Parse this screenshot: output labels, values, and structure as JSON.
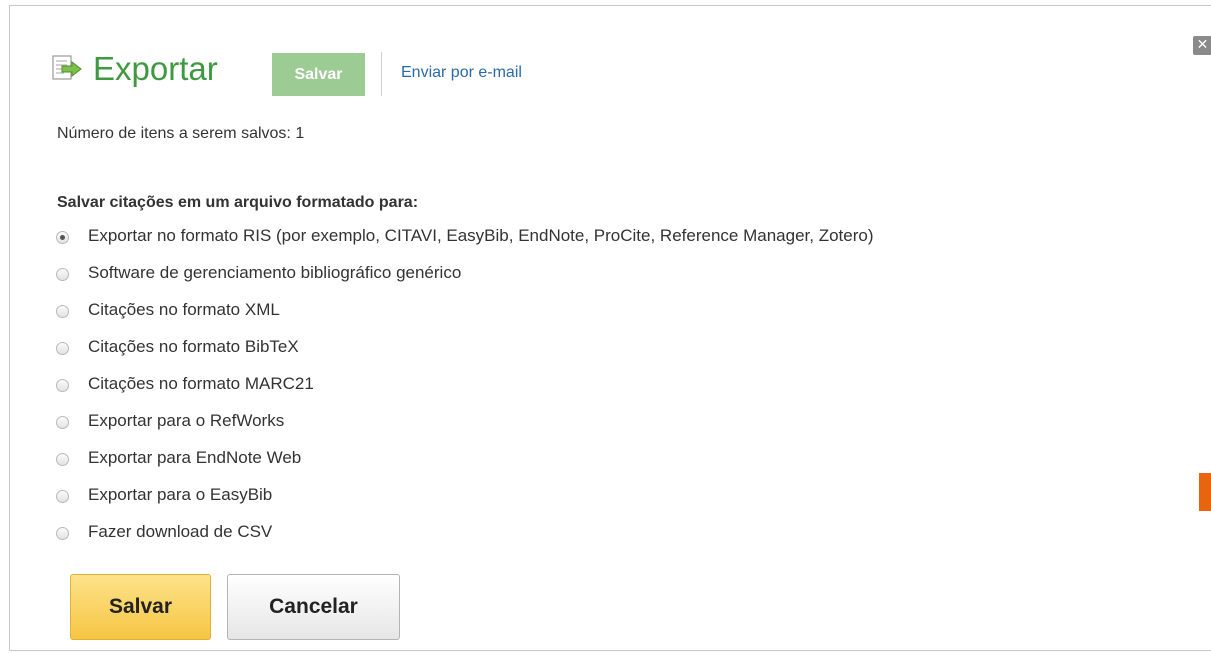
{
  "dialog": {
    "title": "Exportar",
    "title_color": "#3f9a3f",
    "title_icon": "export-document-icon",
    "close_icon": "close-icon",
    "close_glyph": "✕"
  },
  "tabs": {
    "save_label": "Salvar",
    "email_label": "Enviar por e-mail"
  },
  "items_count_text": "Número de itens a serem salvos: 1",
  "formats": {
    "heading": "Salvar citações em um arquivo formatado para:",
    "selected_index": 0,
    "options": [
      {
        "label": "Exportar no formato RIS (por exemplo, CITAVI, EasyBib, EndNote, ProCite, Reference Manager, Zotero)",
        "checked": true
      },
      {
        "label": "Software de gerenciamento bibliográfico genérico",
        "checked": false
      },
      {
        "label": "Citações no formato XML",
        "checked": false
      },
      {
        "label": "Citações no formato BibTeX",
        "checked": false
      },
      {
        "label": "Citações no formato MARC21",
        "checked": false
      },
      {
        "label": "Exportar para o RefWorks",
        "checked": false
      },
      {
        "label": "Exportar para EndNote Web",
        "checked": false
      },
      {
        "label": "Exportar para o EasyBib",
        "checked": false
      },
      {
        "label": "Fazer download de CSV",
        "checked": false
      }
    ]
  },
  "actions": {
    "save_label": "Salvar",
    "cancel_label": "Cancelar",
    "save_color": "#f6c544"
  },
  "accent_side_tab_color": "#e8640f"
}
